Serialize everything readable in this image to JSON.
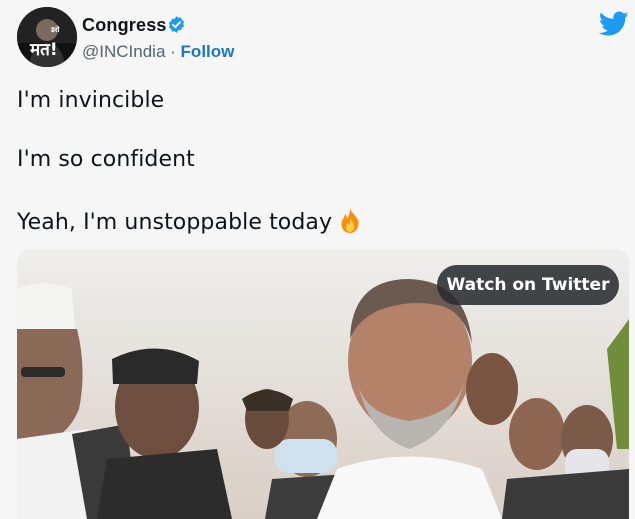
{
  "author": {
    "name": "Congress",
    "handle": "@INCIndia",
    "separator": "·",
    "follow_label": "Follow",
    "avatar_text": "मत!",
    "avatar_small_text": "डरो"
  },
  "tweet": {
    "lines": [
      "I'm invincible",
      "I'm so confident",
      "Yeah, I'm unstoppable today"
    ],
    "emoji": "fire-emoji"
  },
  "media": {
    "watch_label": "Watch on Twitter"
  },
  "colors": {
    "twitter_blue": "#1d9bf0",
    "follow_blue": "#1d77c6",
    "background": "#f5f6f5",
    "overlay_button": "#2c3034"
  },
  "icons": [
    "verified-badge-icon",
    "twitter-bird-icon",
    "fire-emoji"
  ]
}
